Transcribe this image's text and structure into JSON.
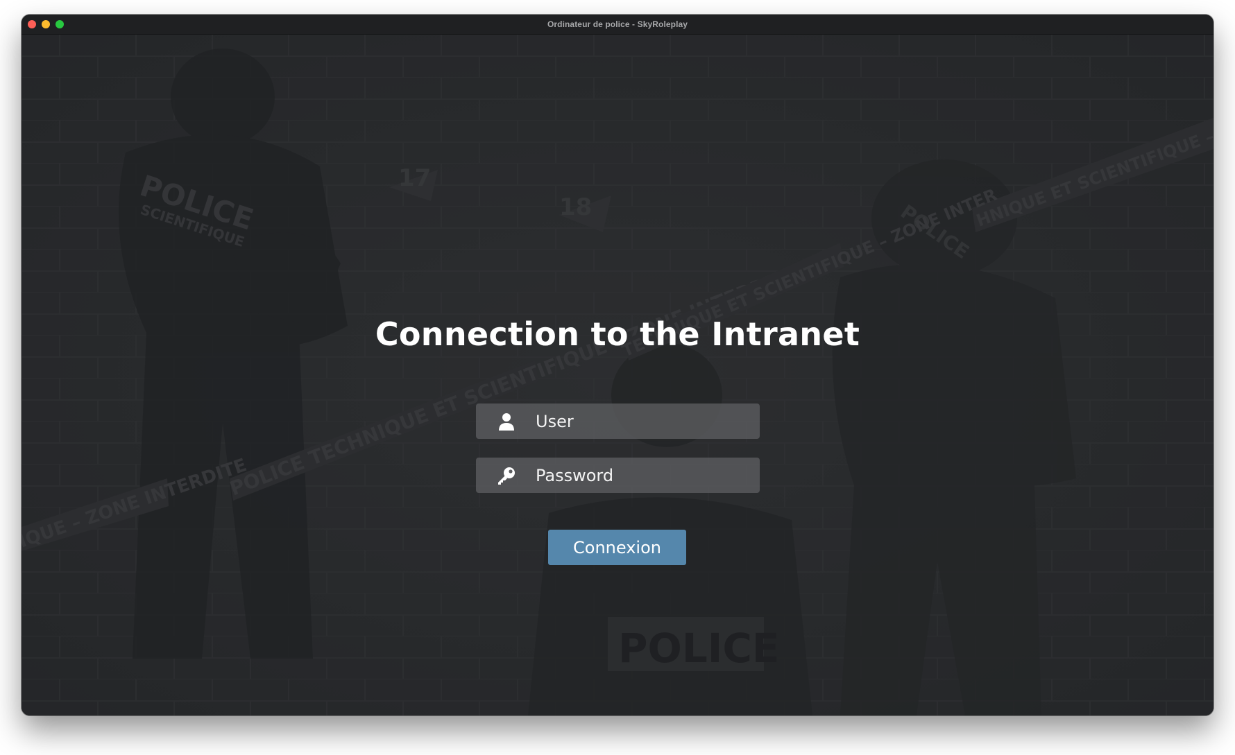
{
  "window": {
    "title": "Ordinateur de police - SkyRoleplay",
    "traffic_lights": [
      "close",
      "minimize",
      "maximize"
    ]
  },
  "background": {
    "description_icon": "police-crime-scene-photo",
    "texts": [
      "POLICE",
      "SCIENTIFIQUE",
      "17",
      "18",
      "POLICE",
      "POLICE",
      "POLICE TECHNIQUE ET SCIENTIFIQUE – ZONE INTERDITE",
      "HNIQUE ET SCIENTIFIQUE – ZONE INTERDITE",
      "TECHNIQUE ET SCIENTIFIQUE – ZONE INTER",
      "IQUE – ZONE INTERDITE"
    ]
  },
  "login": {
    "heading": "Connection to the Intranet",
    "user": {
      "icon": "user-icon",
      "placeholder": "User",
      "value": ""
    },
    "password": {
      "icon": "key-icon",
      "placeholder": "Password",
      "value": ""
    },
    "submit_label": "Connexion"
  },
  "colors": {
    "background": "#2b2c2e",
    "titlebar": "#1f2022",
    "field": "#5c5d60",
    "button": "#5587ac",
    "text": "#ffffff"
  }
}
